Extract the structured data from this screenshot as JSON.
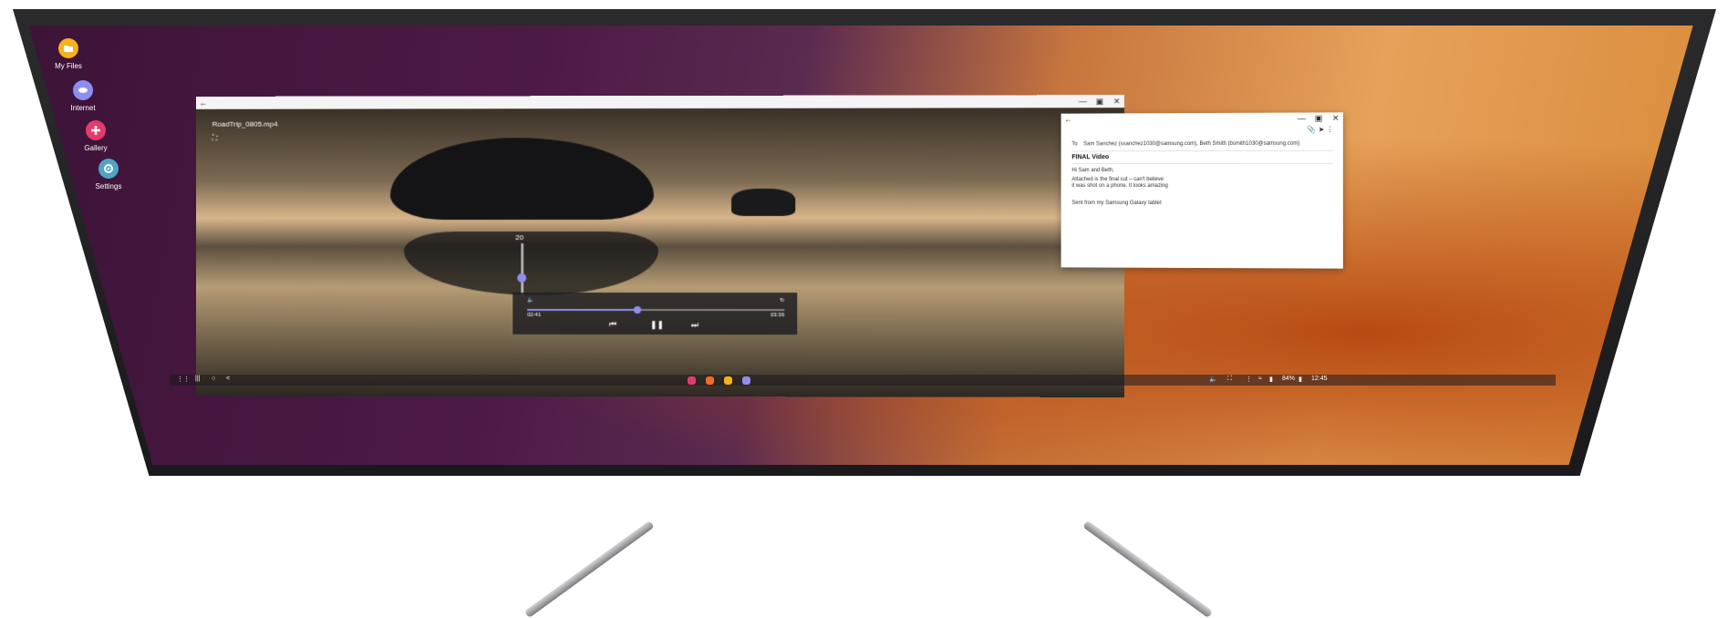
{
  "desktop": {
    "icons": [
      {
        "label": "My Files",
        "icon": "folder-icon",
        "color": "#f5b21b"
      },
      {
        "label": "Internet",
        "icon": "internet-icon",
        "color": "#8e8ef0"
      },
      {
        "label": "Gallery",
        "icon": "gallery-icon",
        "color": "#e43c6a"
      },
      {
        "label": "Settings",
        "icon": "gear-icon",
        "color": "#4fa3c7"
      }
    ]
  },
  "video_player": {
    "filename": "RoadTrip_0805.mp4",
    "volume_level": "20",
    "volume_fraction": 0.35,
    "time_elapsed": "02:41",
    "time_total": "03:36",
    "progress_fraction": 0.43,
    "accent_color": "#8f8ff0"
  },
  "email": {
    "to_label": "To",
    "recipients": "Sam Sanchez (ssanchez1030@samsung.com), Beth Smith (bsmith1030@samsung.com)",
    "subject": "FINAL Video",
    "greeting": "Hi Sam and Beth,",
    "body_line1": "Attached is the final cut – can't believe",
    "body_line2": "it was shot on a phone. It looks amazing",
    "signature": "Sent from my Samsung Galaxy tablet"
  },
  "taskbar": {
    "battery": "84%",
    "time": "12:45",
    "dock_apps": [
      {
        "name": "gallery",
        "color": "#e43c6a"
      },
      {
        "name": "slides",
        "color": "#f26b2a"
      },
      {
        "name": "my-files",
        "color": "#f5b21b"
      },
      {
        "name": "internet",
        "color": "#8e8ef0"
      }
    ]
  }
}
